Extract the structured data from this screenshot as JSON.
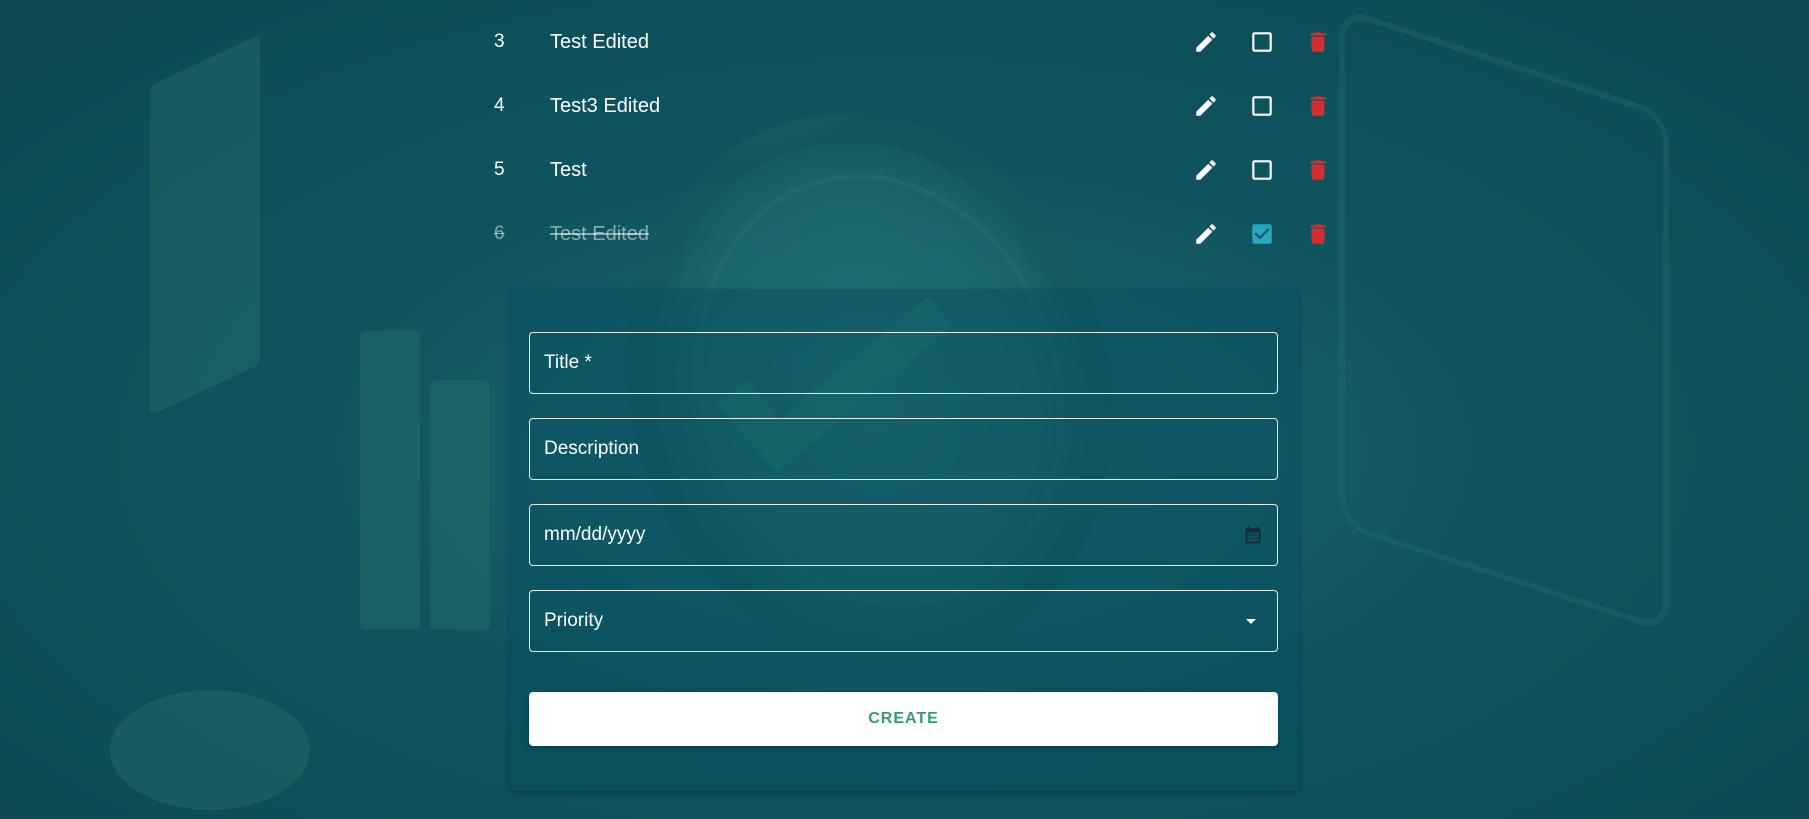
{
  "todos": [
    {
      "index": "3",
      "title": "Test Edited",
      "completed": false
    },
    {
      "index": "4",
      "title": "Test3 Edited",
      "completed": false
    },
    {
      "index": "5",
      "title": "Test",
      "completed": false
    },
    {
      "index": "6",
      "title": "Test Edited",
      "completed": true
    }
  ],
  "icons": {
    "edit": "pencil-icon",
    "checkbox_empty": "checkbox-empty-icon",
    "checkbox_checked": "checkbox-checked-icon",
    "delete": "trash-icon",
    "calendar": "calendar-icon",
    "dropdown": "caret-down-icon"
  },
  "colors": {
    "delete": "#d32f2f",
    "checkbox_checked": "#26a8c0",
    "create_text": "#3a9a6a"
  },
  "form": {
    "title_label": "Title *",
    "description_label": "Description",
    "date_placeholder": "mm/dd/yyyy",
    "priority_label": "Priority",
    "create_label": "CREATE"
  }
}
